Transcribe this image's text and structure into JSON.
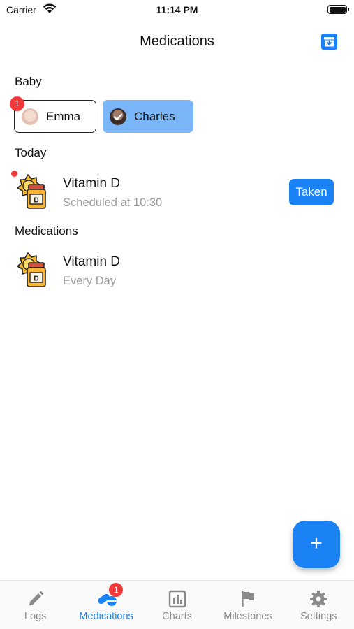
{
  "status_bar": {
    "carrier": "Carrier",
    "time": "11:14 PM"
  },
  "header": {
    "title": "Medications"
  },
  "baby_section": {
    "title": "Baby",
    "babies": [
      {
        "name": "Emma",
        "badge": "1",
        "selected": false
      },
      {
        "name": "Charles",
        "selected": true
      }
    ]
  },
  "today_section": {
    "title": "Today",
    "items": [
      {
        "name": "Vitamin D",
        "subtitle": "Scheduled at 10:30",
        "action_label": "Taken"
      }
    ]
  },
  "medications_section": {
    "title": "Medications",
    "items": [
      {
        "name": "Vitamin D",
        "subtitle": "Every Day"
      }
    ]
  },
  "fab": {
    "label": "+"
  },
  "tab_bar": {
    "tabs": [
      {
        "label": "Logs",
        "icon": "pencil-icon"
      },
      {
        "label": "Medications",
        "icon": "pills-icon",
        "badge": "1",
        "active": true
      },
      {
        "label": "Charts",
        "icon": "chart-icon"
      },
      {
        "label": "Milestones",
        "icon": "flag-icon"
      },
      {
        "label": "Settings",
        "icon": "gear-icon"
      }
    ]
  },
  "colors": {
    "accent": "#1a82f5",
    "selected_chip": "#7ab6f7",
    "badge": "#f0383a",
    "inactive_tab": "#8a8a8a"
  }
}
